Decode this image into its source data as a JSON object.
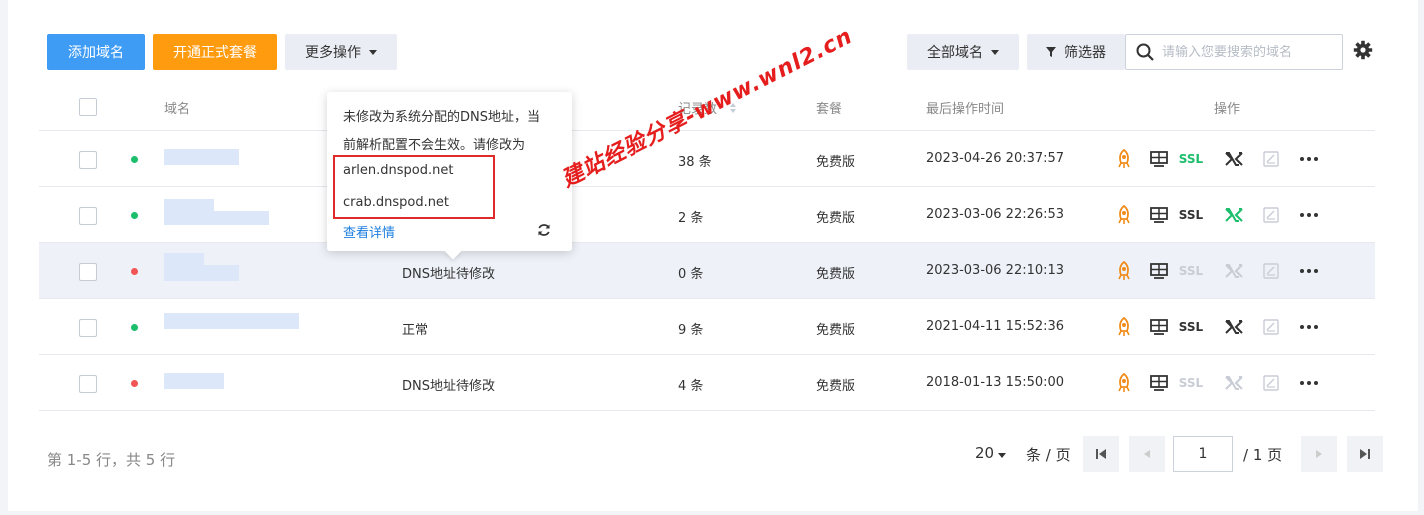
{
  "toolbar": {
    "add_domain": "添加域名",
    "open_package": "开通正式套餐",
    "more_ops": "更多操作",
    "all_domains": "全部域名",
    "filter": "筛选器",
    "search_placeholder": "请输入您要搜索的域名"
  },
  "table": {
    "headers": {
      "domain": "域名",
      "records": "记录数",
      "package": "套餐",
      "last_op": "最后操作时间",
      "actions": "操作"
    },
    "rows": [
      {
        "status_dot": "#1bbf6b",
        "status": "",
        "records": "38 条",
        "package": "免费版",
        "time": "2023-04-26 20:37:57"
      },
      {
        "status_dot": "#1bbf6b",
        "status": "",
        "records": "2 条",
        "package": "免费版",
        "time": "2023-03-06 22:26:53"
      },
      {
        "status_dot": "#f25555",
        "status": "DNS地址待修改",
        "records": "0 条",
        "package": "免费版",
        "time": "2023-03-06 22:10:13"
      },
      {
        "status_dot": "#1bbf6b",
        "status": "正常",
        "records": "9 条",
        "package": "免费版",
        "time": "2021-04-11 15:52:36"
      },
      {
        "status_dot": "#f25555",
        "status": "DNS地址待修改",
        "records": "4 条",
        "package": "免费版",
        "time": "2018-01-13 15:50:00"
      }
    ],
    "ssl_label": "SSL"
  },
  "popover": {
    "line1": "未修改为系统分配的DNS地址，当",
    "line2": "前解析配置不会生效。请修改为",
    "dns1": "arlen.dnspod.net",
    "dns2": "crab.dnspod.net",
    "link": "查看详情"
  },
  "watermark": "建站经验分享-www.wnl2.cn",
  "footer": {
    "summary": "第 1-5 行，共 5 行",
    "page_size": "20",
    "per_page": "条 / 页",
    "page": "1",
    "total_pages": "/ 1 页"
  },
  "colors": {
    "primary": "#3f9cf5",
    "orange": "#ff9b0f",
    "status_red": "#e54545",
    "status_green": "#1bbf6b"
  }
}
